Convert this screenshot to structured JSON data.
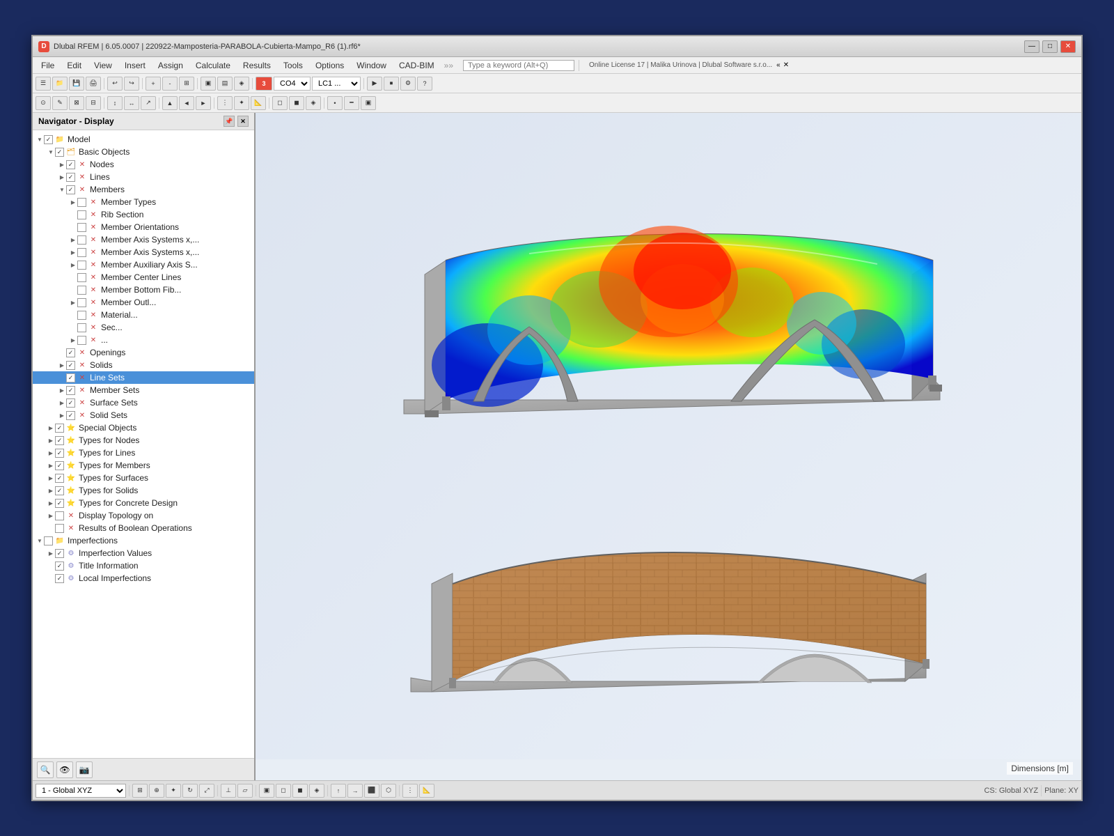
{
  "window": {
    "title": "Dlubal RFEM | 6.05.0007 | 220922-Mamposteria-PARABOLA-Cubierta-Mampo_R6 (1).rf6*",
    "icon": "D",
    "min_btn": "—",
    "max_btn": "□",
    "close_btn": "✕"
  },
  "menubar": {
    "items": [
      "File",
      "Edit",
      "View",
      "Insert",
      "Assign",
      "Calculate",
      "Results",
      "Tools",
      "Options",
      "Window",
      "CAD-BIM"
    ],
    "search_placeholder": "Type a keyword (Alt+Q)",
    "license_text": "Online License 17 | Malika Urinova | Dlubal Software s.r.o..."
  },
  "navigator": {
    "title": "Navigator - Display",
    "tree": [
      {
        "id": "model",
        "label": "Model",
        "level": 0,
        "expanded": true,
        "checked": true,
        "partial": false,
        "icon": "folder"
      },
      {
        "id": "basic-objects",
        "label": "Basic Objects",
        "level": 1,
        "expanded": true,
        "checked": true,
        "partial": false,
        "icon": "folder"
      },
      {
        "id": "nodes",
        "label": "Nodes",
        "level": 2,
        "expanded": false,
        "checked": true,
        "partial": false,
        "icon": "node"
      },
      {
        "id": "lines",
        "label": "Lines",
        "level": 2,
        "expanded": false,
        "checked": true,
        "partial": false,
        "icon": "line"
      },
      {
        "id": "members",
        "label": "Members",
        "level": 2,
        "expanded": true,
        "checked": true,
        "partial": false,
        "icon": "member"
      },
      {
        "id": "member-types",
        "label": "Member Types",
        "level": 3,
        "expanded": false,
        "checked": false,
        "partial": false,
        "icon": "x"
      },
      {
        "id": "rib-section",
        "label": "Rib Section",
        "level": 3,
        "expanded": false,
        "checked": false,
        "partial": false,
        "icon": "x"
      },
      {
        "id": "member-orientations",
        "label": "Member Orientations",
        "level": 3,
        "expanded": false,
        "checked": false,
        "partial": false,
        "icon": "x"
      },
      {
        "id": "member-axis-x1",
        "label": "Member Axis Systems x,...",
        "level": 3,
        "expanded": false,
        "checked": false,
        "partial": false,
        "icon": "x"
      },
      {
        "id": "member-axis-x2",
        "label": "Member Axis Systems x,...",
        "level": 3,
        "expanded": false,
        "checked": false,
        "partial": false,
        "icon": "x"
      },
      {
        "id": "member-aux",
        "label": "Member Auxiliary Axis S...",
        "level": 3,
        "expanded": false,
        "checked": false,
        "partial": false,
        "icon": "x"
      },
      {
        "id": "member-center",
        "label": "Member Center Lines",
        "level": 3,
        "expanded": false,
        "checked": false,
        "partial": false,
        "icon": "x"
      },
      {
        "id": "member-bottom",
        "label": "Member Bottom Fib...",
        "level": 3,
        "expanded": false,
        "checked": false,
        "partial": false,
        "icon": "x"
      },
      {
        "id": "member-outline",
        "label": "Member Outl...",
        "level": 3,
        "expanded": false,
        "checked": false,
        "partial": false,
        "icon": "x"
      },
      {
        "id": "material",
        "label": "Material...",
        "level": 3,
        "expanded": false,
        "checked": false,
        "partial": false,
        "icon": "x"
      },
      {
        "id": "section",
        "label": "Sec...",
        "level": 3,
        "expanded": false,
        "checked": false,
        "partial": false,
        "icon": "x"
      },
      {
        "id": "surfaces-group",
        "label": "...",
        "level": 3,
        "expanded": false,
        "checked": false,
        "partial": false,
        "icon": "x"
      },
      {
        "id": "openings",
        "label": "Openings",
        "level": 2,
        "expanded": false,
        "checked": true,
        "partial": false,
        "icon": "x"
      },
      {
        "id": "solids",
        "label": "Solids",
        "level": 2,
        "expanded": false,
        "checked": true,
        "partial": false,
        "icon": "x"
      },
      {
        "id": "line-sets",
        "label": "Line Sets",
        "level": 2,
        "expanded": false,
        "checked": true,
        "partial": false,
        "icon": "x",
        "selected": true
      },
      {
        "id": "member-sets",
        "label": "Member Sets",
        "level": 2,
        "expanded": false,
        "checked": true,
        "partial": false,
        "icon": "x"
      },
      {
        "id": "surface-sets",
        "label": "Surface Sets",
        "level": 2,
        "expanded": false,
        "checked": true,
        "partial": false,
        "icon": "x"
      },
      {
        "id": "solid-sets",
        "label": "Solid Sets",
        "level": 2,
        "expanded": false,
        "checked": true,
        "partial": false,
        "icon": "x"
      },
      {
        "id": "special-objects",
        "label": "Special Objects",
        "level": 1,
        "expanded": false,
        "checked": true,
        "partial": false,
        "icon": "star"
      },
      {
        "id": "types-nodes",
        "label": "Types for Nodes",
        "level": 1,
        "expanded": false,
        "checked": true,
        "partial": false,
        "icon": "star"
      },
      {
        "id": "types-lines",
        "label": "Types for Lines",
        "level": 1,
        "expanded": false,
        "checked": true,
        "partial": false,
        "icon": "star"
      },
      {
        "id": "types-members",
        "label": "Types for Members",
        "level": 1,
        "expanded": false,
        "checked": true,
        "partial": false,
        "icon": "star"
      },
      {
        "id": "types-surfaces",
        "label": "Types for Surfaces",
        "level": 1,
        "expanded": false,
        "checked": true,
        "partial": false,
        "icon": "star"
      },
      {
        "id": "types-solids",
        "label": "Types for Solids",
        "level": 1,
        "expanded": false,
        "checked": true,
        "partial": false,
        "icon": "star"
      },
      {
        "id": "types-concrete",
        "label": "Types for Concrete Design",
        "level": 1,
        "expanded": false,
        "checked": true,
        "partial": false,
        "icon": "star"
      },
      {
        "id": "display-topology",
        "label": "Display Topology on",
        "level": 1,
        "expanded": false,
        "checked": false,
        "partial": false,
        "icon": "star"
      },
      {
        "id": "results-boolean",
        "label": "Results of Boolean Operations",
        "level": 1,
        "expanded": false,
        "checked": false,
        "partial": false,
        "icon": "x"
      },
      {
        "id": "imperfections",
        "label": "Imperfections",
        "level": 0,
        "expanded": true,
        "checked": false,
        "partial": false,
        "icon": "folder"
      },
      {
        "id": "imperfection-values",
        "label": "Imperfection Values",
        "level": 1,
        "expanded": false,
        "checked": true,
        "partial": false,
        "icon": "imperfection"
      },
      {
        "id": "title-information",
        "label": "Title Information",
        "level": 1,
        "expanded": false,
        "checked": true,
        "partial": false,
        "icon": "imperfection"
      },
      {
        "id": "local-imperfections",
        "label": "Local Imperfections",
        "level": 1,
        "expanded": false,
        "checked": true,
        "partial": false,
        "icon": "imperfection"
      }
    ]
  },
  "viewport": {
    "dimensions_label": "Dimensions [m]"
  },
  "statusbar": {
    "coordinate_system": "1 - Global XYZ",
    "cs_label": "CS: Global XYZ",
    "plane_label": "Plane: XY"
  },
  "toolbar": {
    "color_indicator": "3",
    "load_case": "CO4",
    "load_combo": "LC1 ..."
  }
}
